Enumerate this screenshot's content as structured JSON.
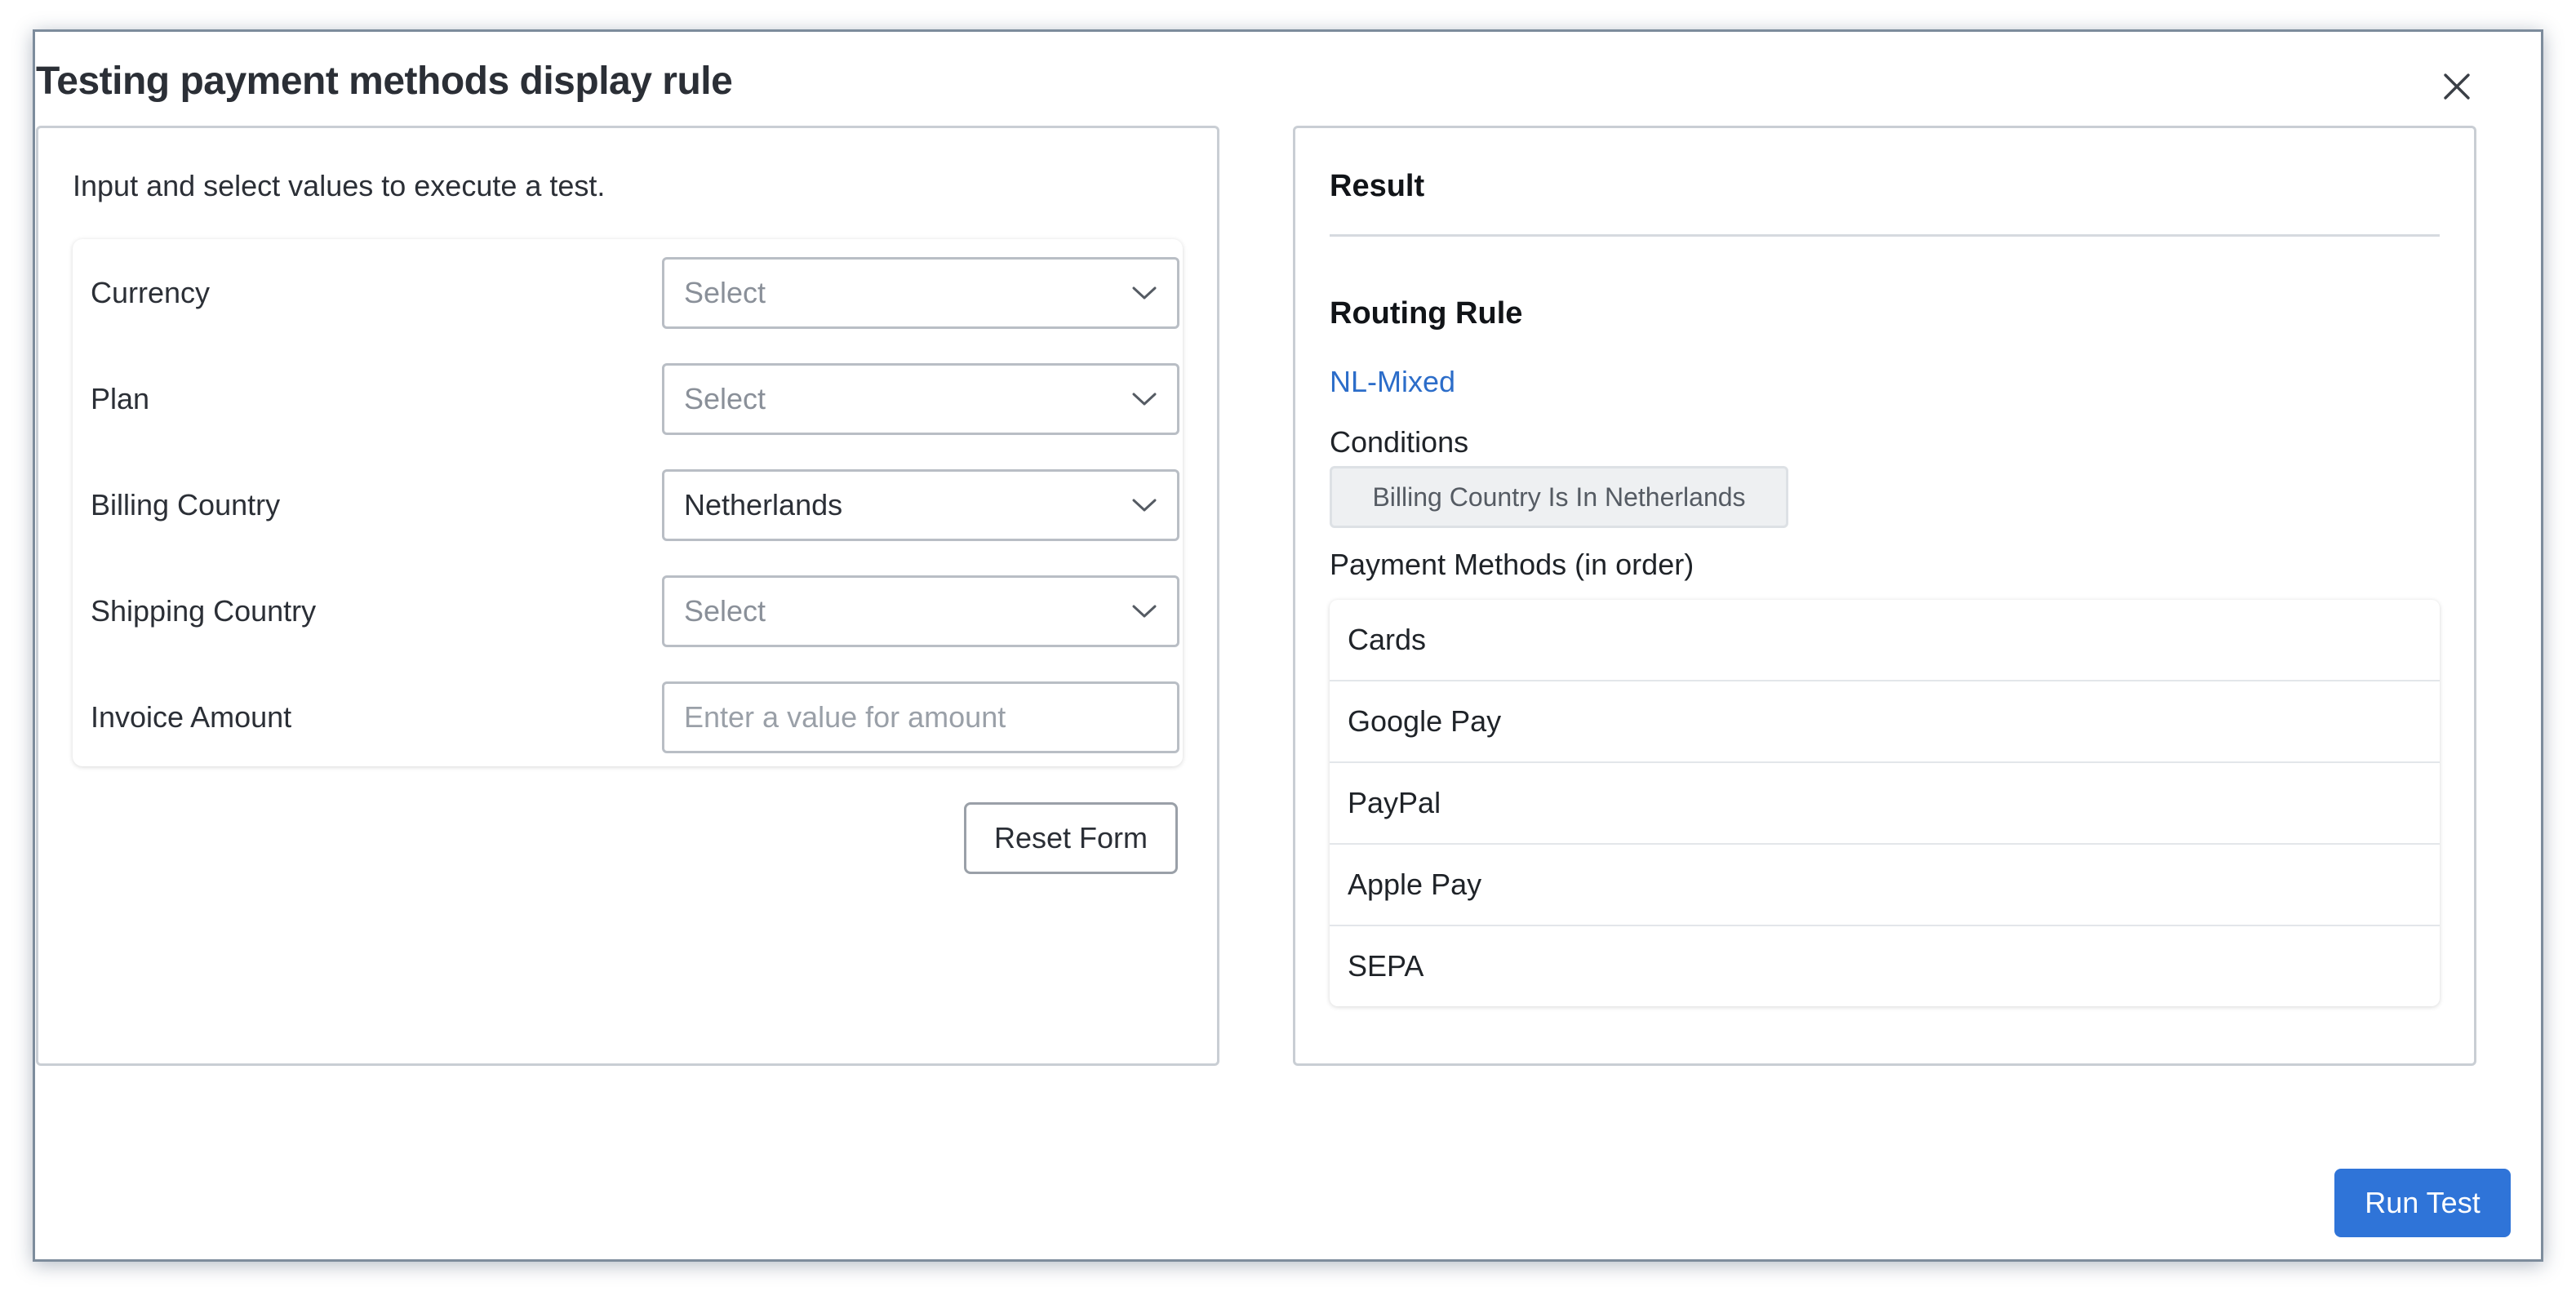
{
  "dialog": {
    "title": "Testing payment methods display rule",
    "close_icon": "close-icon"
  },
  "form": {
    "instructions": "Input and select values to execute a test.",
    "fields": [
      {
        "label": "Currency",
        "value": "Select",
        "placeholder": true
      },
      {
        "label": "Plan",
        "value": "Select",
        "placeholder": true
      },
      {
        "label": "Billing Country",
        "value": "Netherlands",
        "placeholder": false
      },
      {
        "label": "Shipping Country",
        "value": "Select",
        "placeholder": true
      }
    ],
    "amount": {
      "label": "Invoice Amount",
      "value": "",
      "placeholder": "Enter a value for amount"
    },
    "reset_label": "Reset Form"
  },
  "result": {
    "heading": "Result",
    "routing_heading": "Routing Rule",
    "rule_name": "NL-Mixed",
    "conditions_label": "Conditions",
    "condition": "Billing Country Is In Netherlands",
    "methods_label": "Payment Methods (in order)",
    "methods": [
      "Cards",
      "Google Pay",
      "PayPal",
      "Apple Pay",
      "SEPA"
    ]
  },
  "footer": {
    "run_label": "Run Test"
  },
  "colors": {
    "primary": "#2f74d8",
    "link": "#2c6dc9",
    "border": "#c9ced4"
  }
}
